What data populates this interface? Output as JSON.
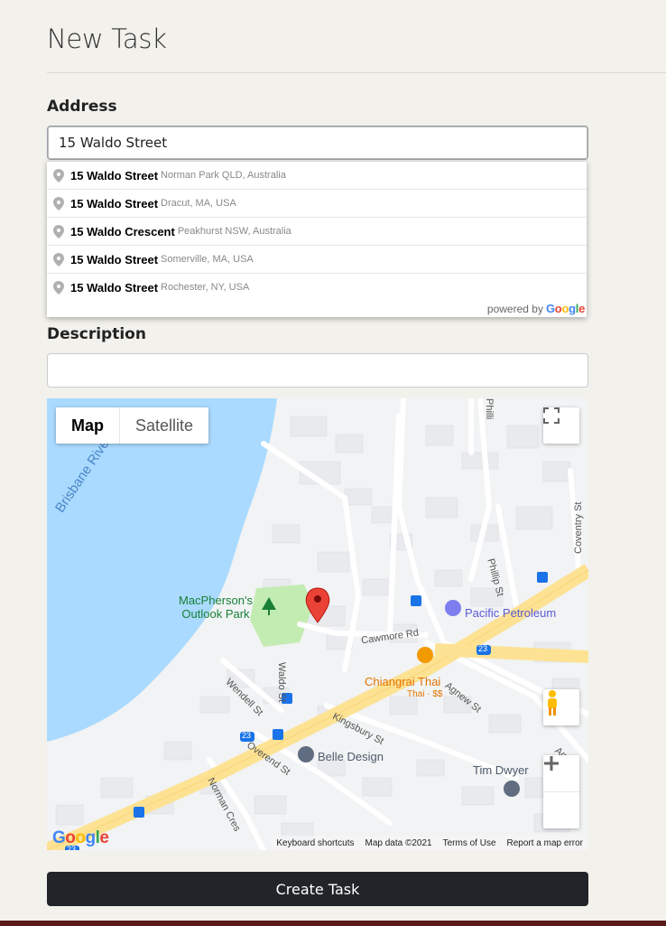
{
  "page": {
    "title": "New Task"
  },
  "address": {
    "label": "Address",
    "value": "15 Waldo Street",
    "suggestions": [
      {
        "main": "15 Waldo Street",
        "secondary": "Norman Park QLD, Australia"
      },
      {
        "main": "15 Waldo Street",
        "secondary": "Dracut, MA, USA"
      },
      {
        "main": "15 Waldo Crescent",
        "secondary": "Peakhurst NSW, Australia"
      },
      {
        "main": "15 Waldo Street",
        "secondary": "Somerville, MA, USA"
      },
      {
        "main": "15 Waldo Street",
        "secondary": "Rochester, NY, USA"
      }
    ],
    "powered_by": "powered by",
    "powered_brand": "Google"
  },
  "description": {
    "label": "Description",
    "value": ""
  },
  "map": {
    "type_options": [
      "Map",
      "Satellite"
    ],
    "active_type": "Map",
    "labels": {
      "river": "Brisbane River",
      "park": "MacPherson's\nOutlook Park",
      "petrol": "Pacific Petroleum",
      "restaurant": "Chiangrai Thai",
      "restaurant_sub": "Thai · $$",
      "belle": "Belle Design",
      "tim": "Tim Dwyer"
    },
    "streets": [
      "Waldo St",
      "Wendell St",
      "Cawmore Rd",
      "Agnew St",
      "Kingsbury St",
      "Overend St",
      "Norman Cres",
      "Phillip St",
      "Coventry St",
      "Philli",
      "Agn"
    ],
    "route_badges": [
      "23",
      "23",
      "23"
    ],
    "footer": [
      "Keyboard shortcuts",
      "Map data ©2021",
      "Terms of Use",
      "Report a map error"
    ],
    "brand": "Google"
  },
  "submit_label": "Create Task"
}
